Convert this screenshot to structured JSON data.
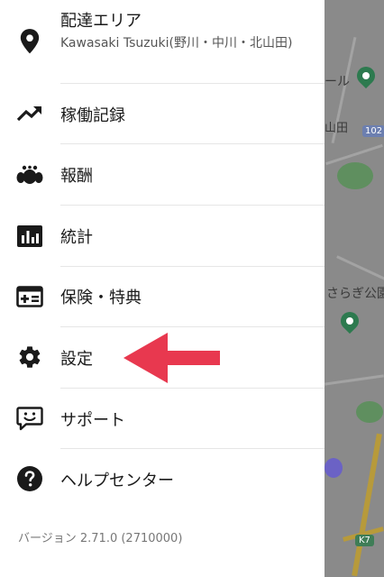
{
  "menu": {
    "area": {
      "title": "配達エリア",
      "subtitle": "Kawasaki Tsuzuki(野川・中川・北山田)",
      "icon": "location-pin-icon"
    },
    "items": [
      {
        "label": "稼働記録",
        "icon": "trending-up-icon"
      },
      {
        "label": "報酬",
        "icon": "coins-icon"
      },
      {
        "label": "統計",
        "icon": "bar-chart-icon"
      },
      {
        "label": "保険・特典",
        "icon": "health-card-icon"
      },
      {
        "label": "設定",
        "icon": "gear-icon"
      },
      {
        "label": "サポート",
        "icon": "support-chat-icon"
      },
      {
        "label": "ヘルプセンター",
        "icon": "help-icon"
      }
    ]
  },
  "version": "バージョン 2.71.0 (2710000)",
  "map": {
    "labels": [
      "ール",
      "山田",
      "さらぎ公園"
    ],
    "route_badge": "102",
    "road_badge": "K7"
  },
  "colors": {
    "arrow": "#e8384f",
    "text": "#1a1a1a",
    "map_background": "#8a8a8a"
  }
}
